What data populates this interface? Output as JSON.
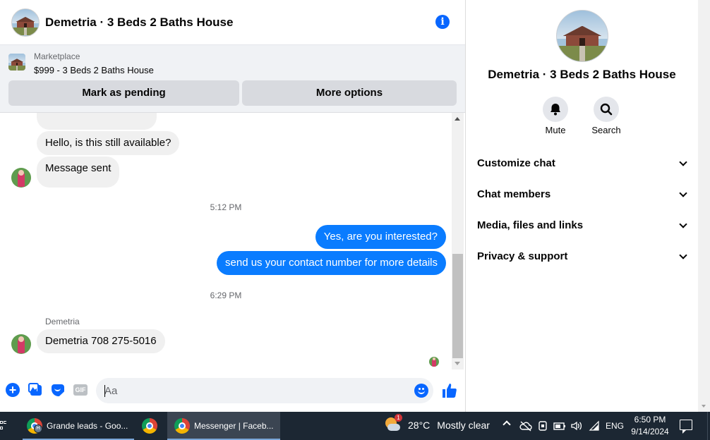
{
  "chat_header": {
    "title": "Demetria · 3 Beds 2 Baths House"
  },
  "marketplace": {
    "label": "Marketplace",
    "listing": "$999 - 3 Beds 2 Baths House",
    "mark_pending": "Mark as pending",
    "more_options": "More options"
  },
  "messages": {
    "m1": "Hello, is this still available?",
    "m2": "Message sent",
    "ts1": "5:12 PM",
    "m3": "Yes, are you interested?",
    "m4": "send us your contact number for more details",
    "ts2": "6:29 PM",
    "sender": "Demetria",
    "m5": "Demetria 708 275-5016"
  },
  "composer": {
    "placeholder": "Aa",
    "gif": "GIF"
  },
  "info_panel": {
    "title": "Demetria · 3 Beds 2 Baths House",
    "mute": "Mute",
    "search": "Search",
    "menu": [
      "Customize chat",
      "Chat members",
      "Media, files and links",
      "Privacy & support"
    ]
  },
  "taskbar": {
    "app1": "Grande leads - Goo...",
    "app2": "Messenger | Faceb...",
    "profile_badge": "H",
    "weather_badge": "1",
    "temperature": "28°C",
    "condition": "Mostly clear",
    "language": "ENG",
    "time": "6:50 PM",
    "date": "9/14/2024"
  },
  "colors": {
    "messenger_blue": "#0a7cff",
    "accent": "#0866ff",
    "taskbar_bg": "#1c2733"
  }
}
